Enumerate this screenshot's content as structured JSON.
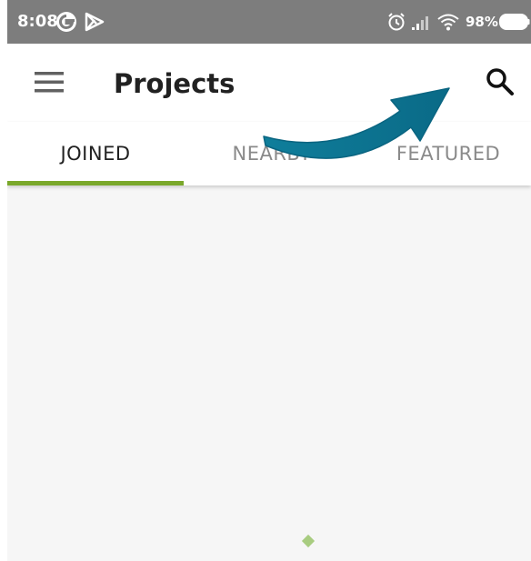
{
  "status_bar": {
    "time": "8:08",
    "battery": "98%",
    "icons": [
      "google-icon",
      "play-store-icon",
      "alarm-icon",
      "signal-icon",
      "wifi-icon",
      "battery-icon"
    ]
  },
  "app_bar": {
    "title": "Projects",
    "menu_icon": "hamburger-menu-icon",
    "search_icon": "search-icon"
  },
  "tabs": [
    {
      "label": "JOINED",
      "selected": true
    },
    {
      "label": "NEARBY",
      "selected": false
    },
    {
      "label": "FEATURED",
      "selected": false
    }
  ],
  "colors": {
    "status_bar": "#7d7d7d",
    "accent": "#7aa82b",
    "annotation_arrow": "#0b6e8c",
    "content_background": "#f6f6f6"
  },
  "annotation": {
    "type": "arrow",
    "points_to": "search-button"
  }
}
